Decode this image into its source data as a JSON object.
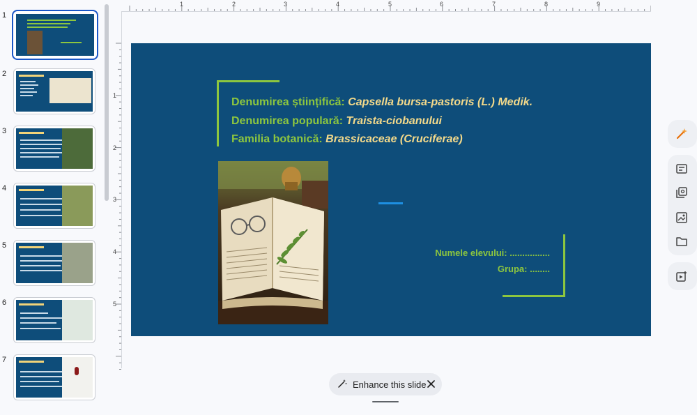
{
  "filmstrip": {
    "slides": [
      {
        "number": "1"
      },
      {
        "number": "2"
      },
      {
        "number": "3"
      },
      {
        "number": "4"
      },
      {
        "number": "5"
      },
      {
        "number": "6"
      },
      {
        "number": "7"
      }
    ],
    "selected_slide": "1"
  },
  "ruler": {
    "top_numbers": [
      "1",
      "2",
      "3",
      "4",
      "5",
      "6",
      "7",
      "8",
      "9"
    ],
    "left_numbers": [
      "1",
      "2",
      "3",
      "4",
      "5"
    ]
  },
  "slide": {
    "line1_label": "Denumirea științifică:",
    "line1_value": "Capsella bursa-pastoris (L.) Medik.",
    "line2_label": "Denumirea populară:",
    "line2_value": "Traista-ciobanului",
    "line3_label": "Familia botanică:",
    "line3_value": "Brassicaceae (Cruciferae)",
    "student_name": "Numele elevului: ................",
    "student_group": "Grupa: ........",
    "colors": {
      "background": "#0e4d7a",
      "accent_green": "#8dc63f",
      "accent_yellow": "#f3d98a",
      "dash_blue": "#1e8fe1"
    }
  },
  "rail": {
    "icons": [
      "gemini-sparkle-icon",
      "speaker-notes-icon",
      "slides-library-icon",
      "insert-image-icon",
      "folder-icon",
      "video-slide-icon"
    ]
  },
  "enhance": {
    "label": "Enhance this slide"
  }
}
